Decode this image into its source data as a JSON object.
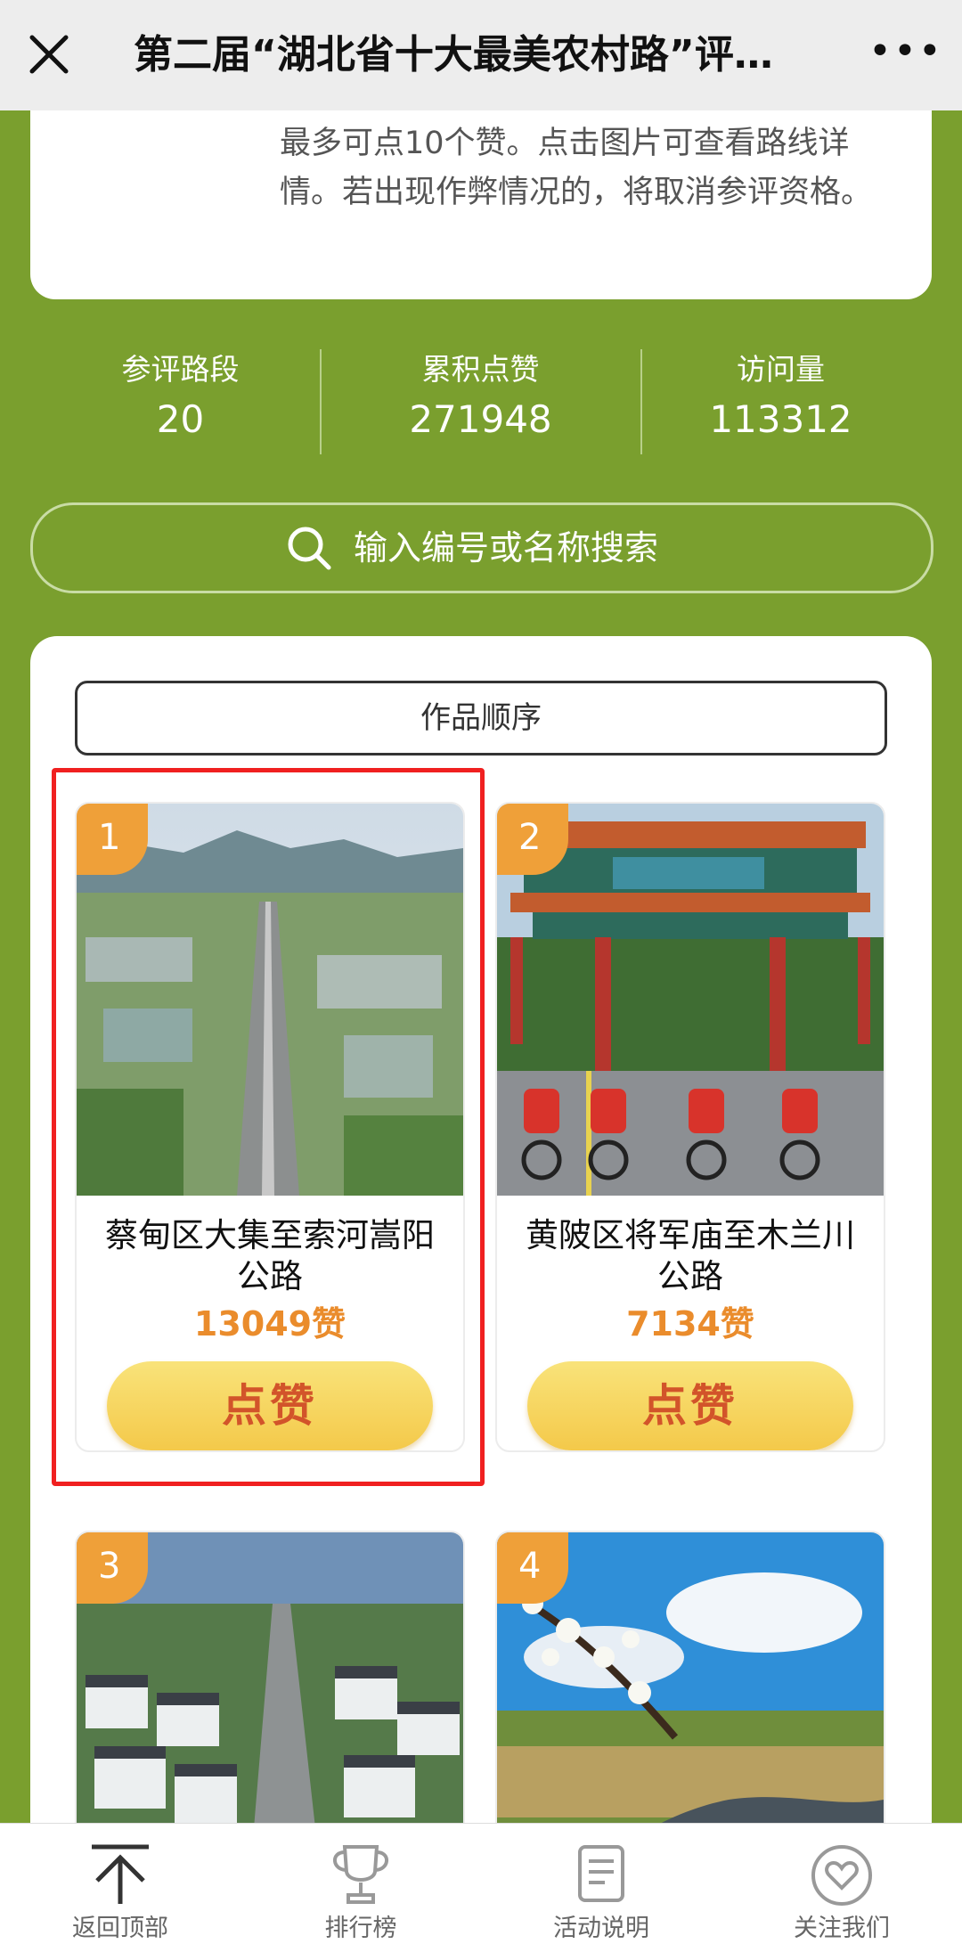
{
  "topbar": {
    "title": "第二届“湖北省十大最美农村路”评选...",
    "close_icon": "close-icon",
    "more_label": "•••"
  },
  "rules": {
    "text": "最多可点10个赞。点击图片可查看路线详情。若出现作弊情况的，将取消参评资格。"
  },
  "stats": [
    {
      "label": "参评路段",
      "value": "20"
    },
    {
      "label": "累积点赞",
      "value": "271948"
    },
    {
      "label": "访问量",
      "value": "113312"
    }
  ],
  "search": {
    "placeholder": "输入编号或名称搜索",
    "icon": "search-icon"
  },
  "sort": {
    "label": "作品顺序"
  },
  "cards": [
    {
      "number": "1",
      "name": "蔡甸区大集至索河嵩阳公路",
      "likes": "13049赞",
      "button": "点赞"
    },
    {
      "number": "2",
      "name": "黄陂区将军庙至木兰川公路",
      "likes": "7134赞",
      "button": "点赞"
    },
    {
      "number": "3"
    },
    {
      "number": "4"
    }
  ],
  "tabs": [
    {
      "label": "返回顶部",
      "icon": "arrow-up-icon"
    },
    {
      "label": "排行榜",
      "icon": "trophy-icon"
    },
    {
      "label": "活动说明",
      "icon": "document-icon"
    },
    {
      "label": "关注我们",
      "icon": "heart-icon"
    }
  ],
  "colors": {
    "background": "#7a9f2e",
    "badge": "#efa039",
    "likes": "#ea8c2c",
    "button_text": "#d2542a",
    "highlight": "#f02020"
  }
}
